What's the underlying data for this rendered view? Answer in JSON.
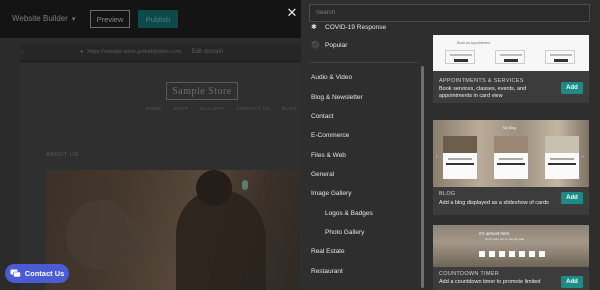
{
  "builder": {
    "brand": "Website Builder",
    "preview_label": "Preview",
    "publish_label": "Publish",
    "site_url": "https://sample-store.godaddysites.com",
    "edit_label": "Edit domain",
    "site_title": "Sample Store",
    "site_nav": [
      "HOME",
      "SHOP",
      "GALLERY",
      "CONTACT US",
      "BLOG"
    ],
    "about_label": "ABOUT US",
    "contact_label": "Contact Us"
  },
  "panel": {
    "search_placeholder": "Search",
    "categories": [
      {
        "label": "COVID-19 Response",
        "icon": "covid-icon"
      },
      {
        "label": "Popular",
        "icon": "flame-icon"
      },
      {
        "label": "Audio & Video"
      },
      {
        "label": "Blog & Newsletter"
      },
      {
        "label": "Contact"
      },
      {
        "label": "E-Commerce"
      },
      {
        "label": "Files & Web"
      },
      {
        "label": "General"
      },
      {
        "label": "Image Gallery"
      },
      {
        "label": "Logos & Badges",
        "sub": true
      },
      {
        "label": "Photo Gallery",
        "sub": true
      },
      {
        "label": "Real Estate"
      },
      {
        "label": "Restaurant"
      }
    ],
    "cards": [
      {
        "name": "APPOINTMENTS & SERVICES",
        "description": "Book services, classes, events, and appointments in card view",
        "add_label": "Add"
      },
      {
        "name": "BLOG",
        "description": "Add a blog displayed as a slideshow of cards",
        "add_label": "Add"
      },
      {
        "name": "COUNTDOWN TIMER",
        "description": "Add a countdown timer to promote limited",
        "add_label": "Add"
      }
    ]
  },
  "colors": {
    "accent": "#1e8c84",
    "contact_button": "#4a5bd4",
    "panel_bg": "#2e2e2e"
  }
}
